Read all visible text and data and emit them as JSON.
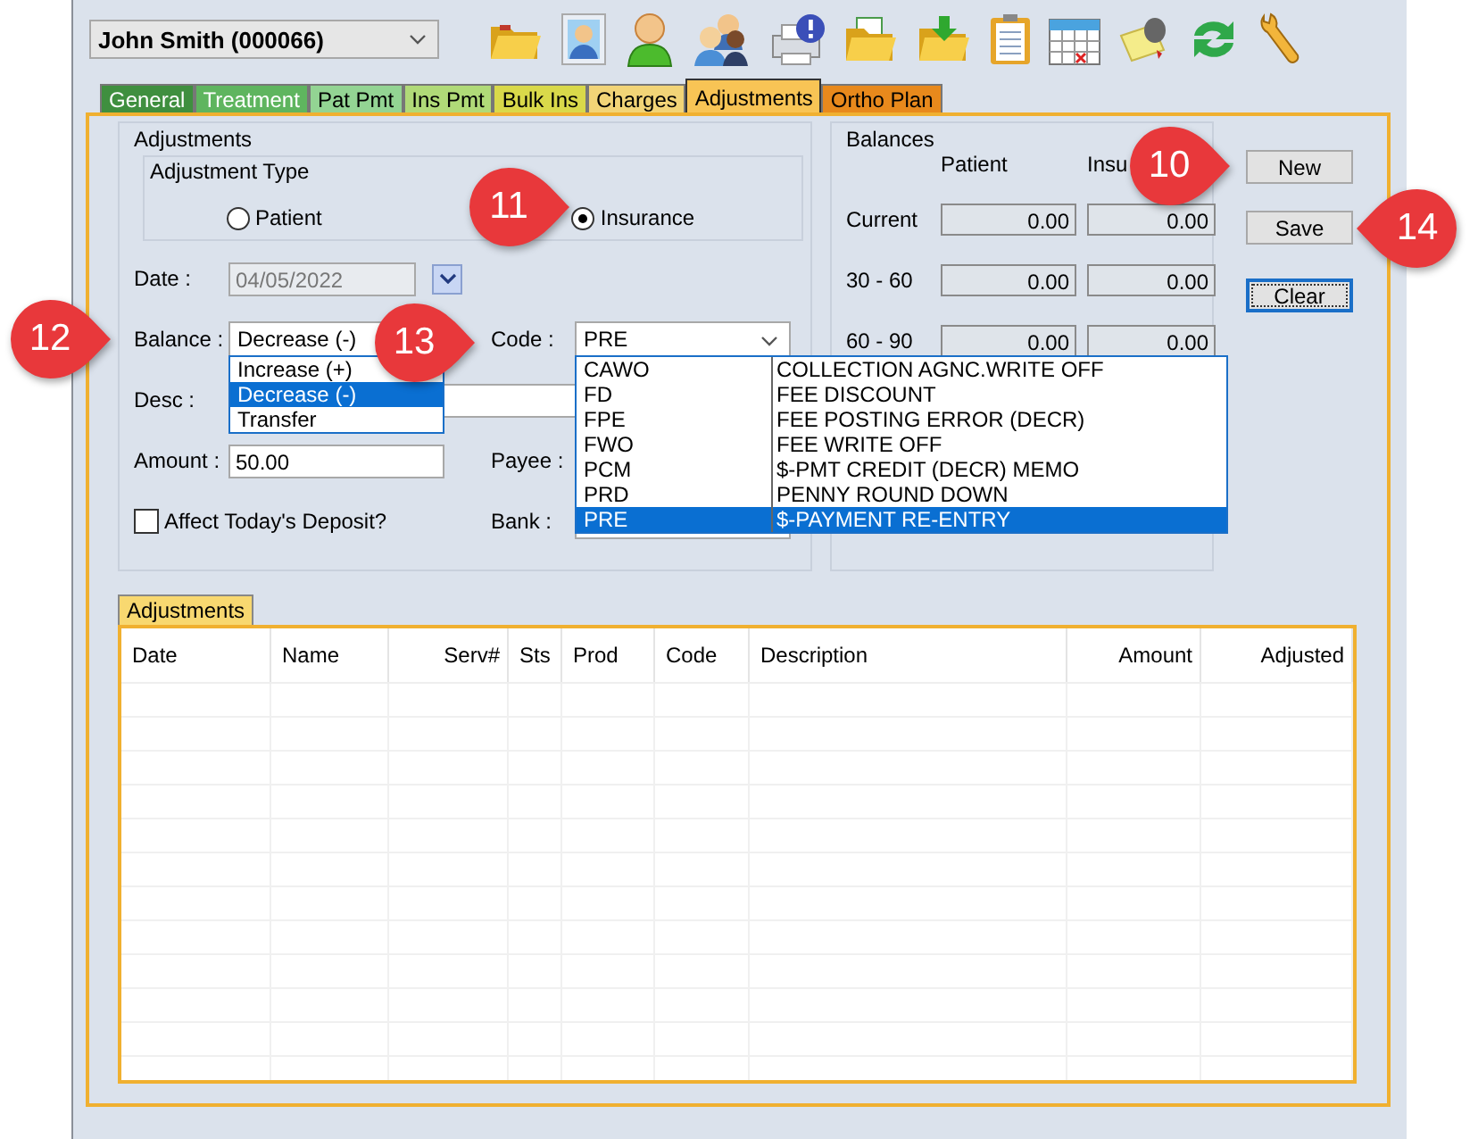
{
  "patient_select": {
    "value": "John Smith (000066)"
  },
  "tabs": [
    {
      "label": "General",
      "color": "#3f8f3f",
      "selected": false
    },
    {
      "label": "Treatment",
      "color": "#5fb55f",
      "selected": false
    },
    {
      "label": "Pat Pmt",
      "color": "#93d493",
      "selected": false
    },
    {
      "label": "Ins Pmt",
      "color": "#b0da78",
      "selected": false
    },
    {
      "label": "Bulk Ins",
      "color": "#d9d94a",
      "selected": false
    },
    {
      "label": "Charges",
      "color": "#f2d477",
      "selected": false
    },
    {
      "label": "Adjustments",
      "color": "#f8c455",
      "selected": true
    },
    {
      "label": "Ortho Plan",
      "color": "#e8891c",
      "selected": false
    }
  ],
  "adjustments": {
    "title": "Adjustments",
    "type_group": {
      "title": "Adjustment Type",
      "options": [
        {
          "label": "Patient",
          "selected": false
        },
        {
          "label": "Insurance",
          "selected": true
        }
      ]
    },
    "date": {
      "label": "Date :",
      "value": "04/05/2022",
      "disabled": true
    },
    "balance": {
      "label": "Balance :",
      "value": "Decrease (-)",
      "expanded": true,
      "options": [
        {
          "label": "Increase (+)",
          "selected": false
        },
        {
          "label": "Decrease (-)",
          "selected": true
        },
        {
          "label": "Transfer",
          "selected": false
        }
      ]
    },
    "code": {
      "label": "Code :",
      "value": "PRE",
      "expanded": true,
      "options": [
        {
          "code": "CAWO",
          "description": "COLLECTION AGNC.WRITE OFF",
          "selected": false
        },
        {
          "code": "FD",
          "description": "FEE DISCOUNT",
          "selected": false
        },
        {
          "code": "FPE",
          "description": "FEE POSTING ERROR (DECR)",
          "selected": false
        },
        {
          "code": "FWO",
          "description": "FEE WRITE OFF",
          "selected": false
        },
        {
          "code": "PCM",
          "description": "$-PMT CREDIT (DECR) MEMO",
          "selected": false
        },
        {
          "code": "PRD",
          "description": "PENNY ROUND DOWN",
          "selected": false
        },
        {
          "code": "PRE",
          "description": "$-PAYMENT RE-ENTRY",
          "selected": true
        }
      ]
    },
    "desc": {
      "label": "Desc :"
    },
    "amount": {
      "label": "Amount :",
      "value": "50.00"
    },
    "payee": {
      "label": "Payee :"
    },
    "bank": {
      "label": "Bank :"
    },
    "deposit": {
      "label": "Affect Today's Deposit?",
      "checked": false
    }
  },
  "balances": {
    "title": "Balances",
    "columns": [
      "Patient",
      "Insu"
    ],
    "rows": [
      {
        "label": "Current",
        "values": [
          "0.00",
          "0.00"
        ]
      },
      {
        "label": "30 - 60",
        "values": [
          "0.00",
          "0.00"
        ]
      },
      {
        "label": "60 - 90",
        "values": [
          "0.00",
          "0.00"
        ]
      }
    ]
  },
  "buttons": [
    {
      "label": "New",
      "focused": false
    },
    {
      "label": "Save",
      "focused": false
    },
    {
      "label": "Clear",
      "focused": true
    }
  ],
  "list": {
    "tab": "Adjustments",
    "columns": [
      "Date",
      "Name",
      "Serv#",
      "Sts",
      "Prod",
      "Code",
      "Description",
      "Amount",
      "Adjusted"
    ]
  },
  "callouts": [
    {
      "number": "12",
      "kind": "right"
    },
    {
      "number": "13",
      "kind": "right"
    },
    {
      "number": "11",
      "kind": "right"
    },
    {
      "number": "10",
      "kind": "right"
    },
    {
      "number": "14",
      "kind": "left"
    }
  ]
}
